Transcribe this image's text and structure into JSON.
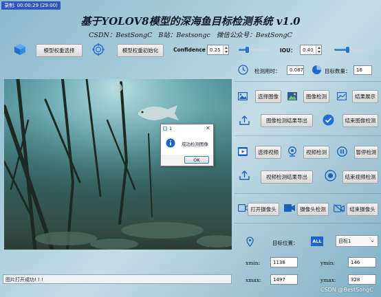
{
  "titlebar": {
    "text": "录制: 00:00:29 (29:00)"
  },
  "header": {
    "title": "基于YOLOV8模型的深海鱼目标检测系统 v1.0",
    "subtitle": "CSDN：BestSongC   B站：Bestsongc   微信公众号：BestSongC"
  },
  "toolbar": {
    "select_weight_label": "模型权重选择",
    "init_weight_label": "模型权重初始化",
    "confidence_label": "Confidence",
    "confidence_value": "0.25",
    "confidence_level": 0.25,
    "iou_label": "IOU：",
    "iou_value": "0.40",
    "iou_level": 0.4
  },
  "stats": {
    "time_label": "检测用时：",
    "time_value": "0.087",
    "count_label": "目标数量：",
    "count_value": "16"
  },
  "image_row": {
    "select_label": "选择图像",
    "detect_label": "图像检测",
    "show_label": "结果展示",
    "export_label": "图像检测结果导出",
    "end_label": "结束图像检测"
  },
  "video_row": {
    "select_label": "选择视频",
    "detect_label": "视频检测",
    "pause_label": "暂停检测",
    "export_label": "视频检测结果导出",
    "end_label": "结束视频检测"
  },
  "camera_row": {
    "open_label": "打开摄像头",
    "detect_label": "摄像头检测",
    "end_label": "结束摄像头"
  },
  "target": {
    "position_label": "目标位置：",
    "all_badge": "ALL",
    "selected_option": "目标1",
    "xmin_label": "xmin:",
    "xmin_value": "1138",
    "ymin_label": "ymin:",
    "ymin_value": "146",
    "xmax_label": "xmax:",
    "xmax_value": "1497",
    "ymax_label": "ymax:",
    "ymax_value": "328"
  },
  "dialog": {
    "title": "1",
    "message": "成功检测图像",
    "ok_label": "OK"
  },
  "status_bar": {
    "text": "图片打开成功! ! !"
  },
  "watermark": "CSDN @BestSongC"
}
